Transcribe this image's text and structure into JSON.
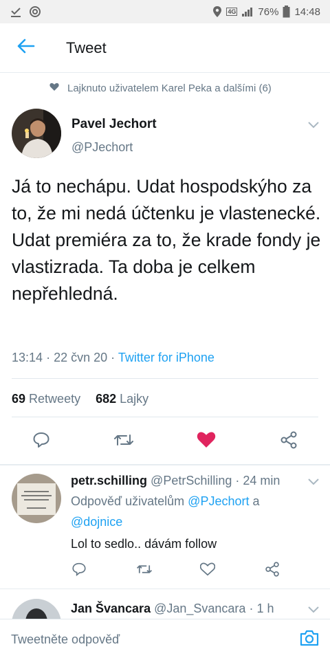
{
  "status_bar": {
    "network": "4G",
    "battery_percent": "76%",
    "time": "14:48"
  },
  "header": {
    "title": "Tweet"
  },
  "social_context": {
    "text": "Lajknuto uživatelem Karel Peka a dalšími (6)"
  },
  "tweet": {
    "author_name": "Pavel Jechort",
    "author_handle": "@PJechort",
    "text": "Já to nechápu. Udat hospodskýho za to, že mi nedá účtenku je vlastenecké. Udat premiéra za to, že krade fondy je vlastizrada. Ta doba je celkem nepřehledná.",
    "time": "13:14",
    "date": "22 čvn 20",
    "source": "Twitter for iPhone",
    "retweet_count": "69",
    "retweet_label": "Retweety",
    "like_count": "682",
    "like_label": "Lajky",
    "liked": true
  },
  "replies": [
    {
      "name": "petr.schilling",
      "handle": "@PetrSchilling",
      "age": "24 min",
      "reply_prefix": "Odpověď uživatelům",
      "mention1": "@PJechort",
      "conjunction": "a",
      "mention2": "@dojnice",
      "text": "Lol to sedlo.. dávám follow"
    },
    {
      "name": "Jan Švancara",
      "handle": "@Jan_Svancara",
      "age": "1 h"
    }
  ],
  "compose": {
    "placeholder": "Tweetněte odpověď"
  },
  "colors": {
    "accent": "#1da1f2",
    "like": "#e0245e",
    "secondary_text": "#657786"
  }
}
